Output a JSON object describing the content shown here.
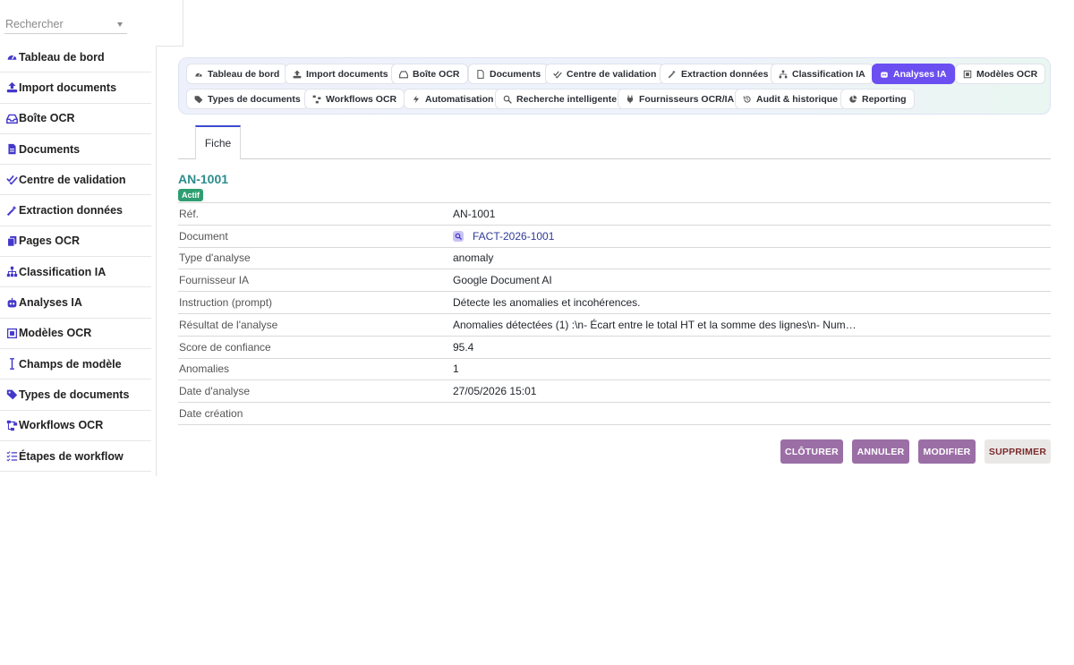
{
  "sidebar": {
    "search_placeholder": "Rechercher",
    "items": [
      {
        "label": "Tableau de bord",
        "icon": "gauge-icon"
      },
      {
        "label": "Import documents",
        "icon": "upload-icon"
      },
      {
        "label": "Boîte OCR",
        "icon": "inbox-icon"
      },
      {
        "label": "Documents",
        "icon": "file-icon"
      },
      {
        "label": "Centre de validation",
        "icon": "check-double-icon"
      },
      {
        "label": "Extraction données",
        "icon": "magic-wand-icon"
      },
      {
        "label": "Pages OCR",
        "icon": "copy-icon"
      },
      {
        "label": "Classification IA",
        "icon": "sitemap-icon"
      },
      {
        "label": "Analyses IA",
        "icon": "robot-icon"
      },
      {
        "label": "Modèles OCR",
        "icon": "object-group-icon"
      },
      {
        "label": "Champs de modèle",
        "icon": "i-cursor-icon"
      },
      {
        "label": "Types de documents",
        "icon": "tags-icon"
      },
      {
        "label": "Workflows OCR",
        "icon": "diagram-icon"
      },
      {
        "label": "Étapes de workflow",
        "icon": "list-check-icon"
      }
    ]
  },
  "topnav": {
    "items": [
      {
        "label": "Tableau de bord",
        "icon": "gauge-icon"
      },
      {
        "label": "Import documents",
        "icon": "upload-icon"
      },
      {
        "label": "Boîte OCR",
        "icon": "inbox-icon"
      },
      {
        "label": "Documents",
        "icon": "file-icon"
      },
      {
        "label": "Centre de validation",
        "icon": "check-double-icon"
      },
      {
        "label": "Extraction données",
        "icon": "magic-wand-icon"
      },
      {
        "label": "Classification IA",
        "icon": "sitemap-icon"
      },
      {
        "label": "Analyses IA",
        "icon": "robot-icon",
        "active": true
      },
      {
        "label": "Modèles OCR",
        "icon": "object-group-icon"
      },
      {
        "label": "Types de documents",
        "icon": "tags-icon"
      },
      {
        "label": "Workflows OCR",
        "icon": "diagram-icon"
      },
      {
        "label": "Automatisation",
        "icon": "bolt-icon"
      },
      {
        "label": "Recherche intelligente",
        "icon": "search-icon"
      },
      {
        "label": "Fournisseurs OCR/IA",
        "icon": "plug-icon"
      },
      {
        "label": "Audit & historique",
        "icon": "history-icon"
      },
      {
        "label": "Reporting",
        "icon": "pie-chart-icon"
      }
    ]
  },
  "tabs": {
    "fiche": "Fiche"
  },
  "record": {
    "title": "AN-1001",
    "status": "Actif",
    "rows": [
      {
        "label": "Réf.",
        "value": "AN-1001"
      },
      {
        "label": "Document",
        "value": "FACT-2026-1001",
        "link": true
      },
      {
        "label": "Type d'analyse",
        "value": "anomaly"
      },
      {
        "label": "Fournisseur IA",
        "value": "Google Document AI"
      },
      {
        "label": "Instruction (prompt)",
        "value": "Détecte les anomalies et incohérences."
      },
      {
        "label": "Résultat de l'analyse",
        "value": "Anomalies détectées (1) :\\n- Écart entre le total HT et la somme des lignes\\n- Num…"
      },
      {
        "label": "Score de confiance",
        "value": "95.4"
      },
      {
        "label": "Anomalies",
        "value": "1"
      },
      {
        "label": "Date d'analyse",
        "value": "27/05/2026 15:01"
      },
      {
        "label": "Date création",
        "value": ""
      }
    ]
  },
  "actions": {
    "close": "CLÔTURER",
    "cancel": "ANNULER",
    "edit": "MODIFIER",
    "delete": "SUPPRIMER"
  },
  "colors": {
    "accent": "#6c4ff0",
    "title": "#2c8d8b",
    "status": "#2e9e70",
    "action": "#9b6fa6",
    "icon": "#4338ca"
  }
}
